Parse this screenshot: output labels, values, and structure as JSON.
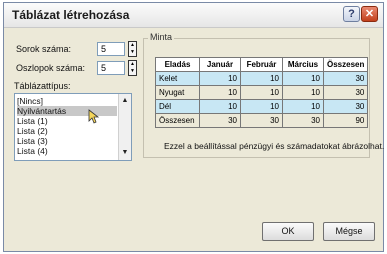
{
  "dialog": {
    "title": "Táblázat létrehozása",
    "help_label": "?",
    "close_label": "✕"
  },
  "rows": {
    "label": "Sorok száma:",
    "value": "5"
  },
  "cols": {
    "label": "Oszlopok száma:",
    "value": "5"
  },
  "table_type": {
    "label": "Táblázattípus:",
    "options": [
      "[Nincs]",
      "Nyilvántartás",
      "Lista (1)",
      "Lista (2)",
      "Lista (3)",
      "Lista (4)"
    ],
    "selected": "Nyilvántartás"
  },
  "preview": {
    "group_title": "Minta",
    "headers": [
      "Eladás",
      "Január",
      "Február",
      "Március",
      "Összesen"
    ],
    "rows": [
      [
        "Kelet",
        "10",
        "10",
        "10",
        "30"
      ],
      [
        "Nyugat",
        "10",
        "10",
        "10",
        "30"
      ],
      [
        "Dél",
        "10",
        "10",
        "10",
        "30"
      ],
      [
        "Összesen",
        "30",
        "30",
        "30",
        "90"
      ]
    ],
    "description": "Ezzel a beállítással pénzügyi és számadatokat ábrázolhat."
  },
  "buttons": {
    "ok": "OK",
    "cancel": "Mégse"
  },
  "colors": {
    "band": "#c8e7f4",
    "selection": "#c8c8c8"
  }
}
